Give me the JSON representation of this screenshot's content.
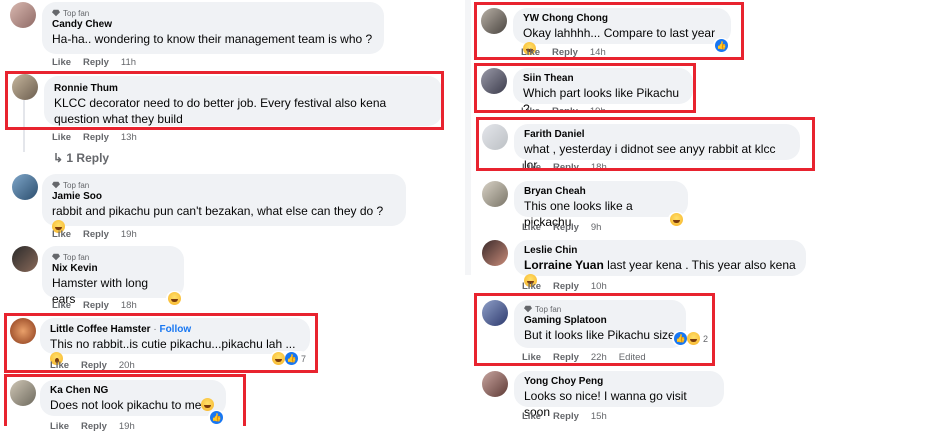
{
  "comments": {
    "candy": {
      "top_fan": "Top fan",
      "author": "Candy Chew",
      "text": "Ha-ha.. wondering to know their management team is who ?",
      "like": "Like",
      "reply": "Reply",
      "time": "11h"
    },
    "ronnie": {
      "author": "Ronnie Thum",
      "text": "KLCC decorator need to do better job. Every festival also kena question what they build",
      "like": "Like",
      "reply": "Reply",
      "time": "13h",
      "replies": "1 Reply"
    },
    "jamie": {
      "top_fan": "Top fan",
      "author": "Jamie Soo",
      "text": "rabbit and pikachu pun can't bezakan, what else can they do ?",
      "like": "Like",
      "reply": "Reply",
      "time": "19h"
    },
    "nix": {
      "top_fan": "Top fan",
      "author": "Nix Kevin",
      "text": "Hamster with long ears",
      "like": "Like",
      "reply": "Reply",
      "time": "18h"
    },
    "littlecoffee": {
      "author": "Little Coffee Hamster",
      "dot": " · ",
      "follow": "Follow",
      "text": "This no rabbit..is cutie pikachu...pikachu lah ...",
      "like": "Like",
      "reply": "Reply",
      "time": "20h",
      "reactions": "7"
    },
    "kachen": {
      "author": "Ka Chen NG",
      "text": "Does not look pikachu to me",
      "like": "Like",
      "reply": "Reply",
      "time": "19h"
    },
    "ywchong": {
      "author": "YW Chong Chong",
      "text": "Okay lahhhh... Compare to last year",
      "like": "Like",
      "reply": "Reply",
      "time": "14h"
    },
    "siin": {
      "author": "Siin Thean",
      "text": "Which part looks like Pikachu ?",
      "like": "Like",
      "reply": "Reply",
      "time": "19h"
    },
    "farith": {
      "author": "Farith Daniel",
      "text": "what , yesterday i didnot see anyy rabbit at klcc lor",
      "like": "Like",
      "reply": "Reply",
      "time": "18h"
    },
    "bryan": {
      "author": "Bryan Cheah",
      "text": "This one looks like a pickachu",
      "like": "Like",
      "reply": "Reply",
      "time": "9h"
    },
    "leslie": {
      "author": "Leslie Chin",
      "mention": "Lorraine Yuan",
      "text": " last year kena . This year also kena",
      "like": "Like",
      "reply": "Reply",
      "time": "10h"
    },
    "gaming": {
      "top_fan": "Top fan",
      "author": "Gaming Splatoon",
      "text": "But it looks like Pikachu size",
      "like": "Like",
      "reply": "Reply",
      "time": "22h",
      "edited": "Edited",
      "reactions": "2"
    },
    "yong": {
      "author": "Yong Choy Peng",
      "text": "Looks so nice! I wanna go visit soon",
      "like": "Like",
      "reply": "Reply",
      "time": "15h"
    }
  },
  "colors": {
    "highlight": "#e8232f",
    "bubble": "#f0f2f5",
    "link": "#1877f2",
    "meta": "#65676b"
  }
}
